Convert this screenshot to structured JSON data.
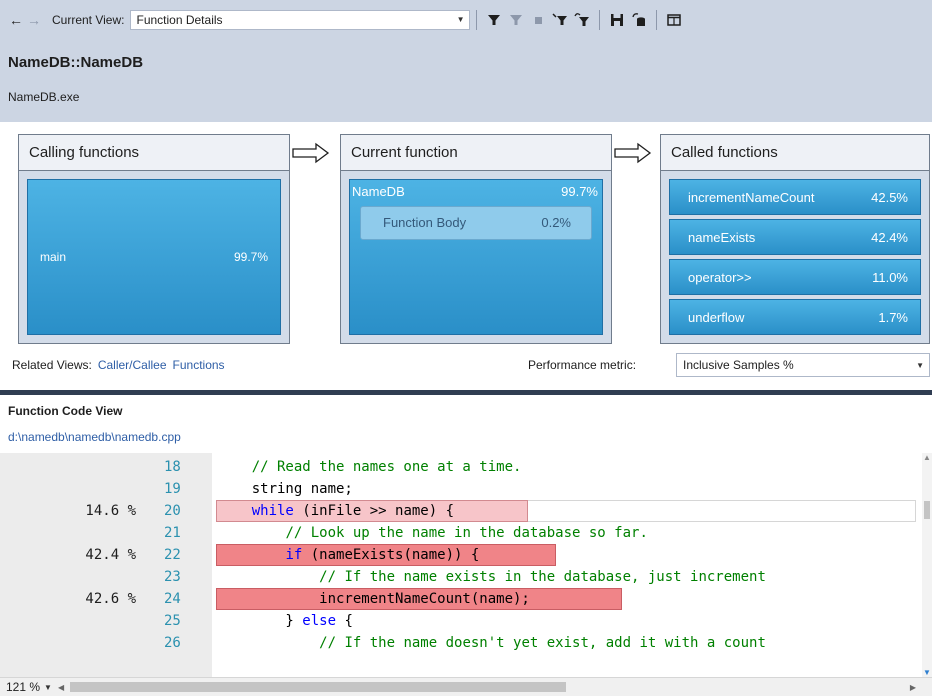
{
  "toolbar": {
    "back_icon": "arrow-left",
    "forward_icon": "arrow-right",
    "current_view_label": "Current View:",
    "current_view_value": "Function Details",
    "icons": [
      "filter-icon",
      "clear-filter-icon",
      "stop-icon",
      "expand-hot-path-icon",
      "show-hot-path-icon",
      "save-icon",
      "export-icon",
      "split-view-icon"
    ]
  },
  "header": {
    "function_name": "NameDB::NameDB",
    "module": "NameDB.exe"
  },
  "calling_panel": {
    "title": "Calling functions",
    "tiles": [
      {
        "name": "main",
        "value": "99.7%"
      }
    ]
  },
  "current_panel": {
    "title": "Current function",
    "name": "NameDB",
    "value": "99.7%",
    "body": {
      "name": "Function Body",
      "value": "0.2%"
    }
  },
  "called_panel": {
    "title": "Called functions",
    "tiles": [
      {
        "name": "incrementNameCount",
        "value": "42.5%"
      },
      {
        "name": "nameExists",
        "value": "42.4%"
      },
      {
        "name": "operator>>",
        "value": "11.0%"
      },
      {
        "name": "underflow",
        "value": "1.7%"
      }
    ]
  },
  "related": {
    "label": "Related Views:",
    "links": [
      "Caller/Callee",
      "Functions"
    ]
  },
  "metric": {
    "label": "Performance metric:",
    "value": "Inclusive Samples %"
  },
  "code_view": {
    "title": "Function Code View",
    "path": "d:\\namedb\\namedb\\namedb.cpp"
  },
  "code_lines": [
    {
      "line": "18",
      "pct": "",
      "text": "    // Read the names one at a time."
    },
    {
      "line": "19",
      "pct": "",
      "text": "    string name;"
    },
    {
      "line": "20",
      "pct": "14.6 %",
      "text": "    while (inFile >> name) {"
    },
    {
      "line": "21",
      "pct": "",
      "text": "        // Look up the name in the database so far."
    },
    {
      "line": "22",
      "pct": "42.4 %",
      "text": "        if (nameExists(name)) {"
    },
    {
      "line": "23",
      "pct": "",
      "text": "            // If the name exists in the database, just increment"
    },
    {
      "line": "24",
      "pct": "42.6 %",
      "text": "            incrementNameCount(name);"
    },
    {
      "line": "25",
      "pct": "",
      "text": "        } else {"
    },
    {
      "line": "26",
      "pct": "",
      "text": "            // If the name doesn't yet exist, add it with a count"
    }
  ],
  "status": {
    "zoom": "121 %"
  }
}
